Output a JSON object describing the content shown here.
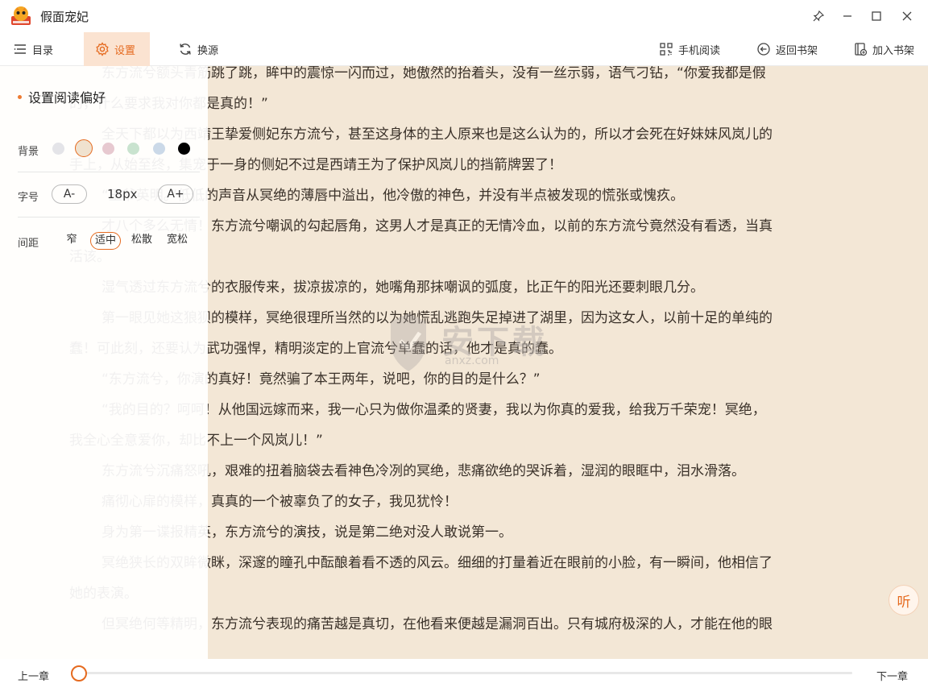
{
  "window": {
    "title": "假面宠妃",
    "logo_icon": "book-mascot-icon",
    "controls": [
      "pin-icon",
      "minimize-icon",
      "maximize-icon",
      "close-icon"
    ]
  },
  "toolbar": {
    "catalog_label": "目录",
    "settings_label": "设置",
    "source_label": "换源",
    "mobile_label": "手机阅读",
    "back_shelf_label": "返回书架",
    "add_shelf_label": "加入书架",
    "accent_color": "#e56a1f"
  },
  "settings": {
    "title": "设置阅读偏好",
    "background_label": "背景",
    "background_colors": [
      "#e4e4e8",
      "#f0e2cf",
      "#e7c9d0",
      "#c9e3cf",
      "#cbd9e8",
      "#000000"
    ],
    "background_selected": 1,
    "font_size_label": "字号",
    "font_decrease": "A-",
    "font_value": "18px",
    "font_increase": "A+",
    "spacing_label": "间距",
    "spacing_options": [
      "窄",
      "适中",
      "松散",
      "宽松"
    ],
    "spacing_selected": 1
  },
  "content": {
    "lines": [
      "东方流兮额头青筋跳了跳，眸中的震惊一闪而过，她傲然的抬着头，没有一丝示弱，语气刁钻，“你爱我都是假",
      "的，什么要求我对你都是真的！”",
      "全天下都以为西靖王挚爱侧妃东方流兮，甚至这身体的主人原来也是这么认为的，所以才会死在好妹妹风岚儿的",
      "手上，从始至终，集宠于一身的侧妃不过是西靖王为了保护风岚儿的挡箭牌罢了！",
      "“王爷英明。”低低的声音从冥绝的薄唇中溢出，他冷傲的神色，并没有半点被发现的慌张或愧疚。",
      "才八个多么无情！东方流兮嘲讽的勾起唇角，这男人才是真正的无情冷血，以前的东方流兮竟然没有看透，当真",
      "活该。",
      "湿气透过东方流兮的衣服传来，拔凉拔凉的，她嘴角那抹嘲讽的弧度，比正午的阳光还要刺眼几分。",
      "第一眼见她这狼狈的模样，冥绝很理所当然的以为她慌乱逃跑失足掉进了湖里，因为这女人，以前十足的单纯的",
      "蠢！可此刻，还要认为武功强悍，精明淡定的上官流兮单蠢的话，他才是真的蠢。",
      "“东方流兮，你演的真好！竟然骗了本王两年，说吧，你的目的是什么？”",
      "“我的目的？呵呵！从他国远嫁而来，我一心只为做你温柔的贤妻，我以为你真的爱我，给我万千荣宠！冥绝，",
      "我全心全意爱你，却比不上一个风岚儿！”",
      "东方流兮沉痛怒吼，艰难的扭着脑袋去看神色冷冽的冥绝，悲痛欲绝的哭诉着，湿润的眼眶中，泪水滑落。",
      "痛彻心扉的模样，真真的一个被辜负了的女子，我见犹怜！",
      "身为第一谍报精英，东方流兮的演技，说是第二绝对没人敢说第一。",
      "冥绝狭长的双眸微眯，深邃的瞳孔中酝酿着看不透的风云。细细的打量着近在眼前的小脸，有一瞬间，他相信了",
      "她的表演。",
      "但冥绝何等精明，东方流兮表现的痛苦越是真切，在他看来便越是漏洞百出。只有城府极深的人，才能在他的眼"
    ],
    "watermark_title": "安下载",
    "watermark_sub": "anxz.com"
  },
  "listen_label": "听",
  "bottom": {
    "prev_label": "上一章",
    "next_label": "下一章",
    "progress": 0.0
  }
}
